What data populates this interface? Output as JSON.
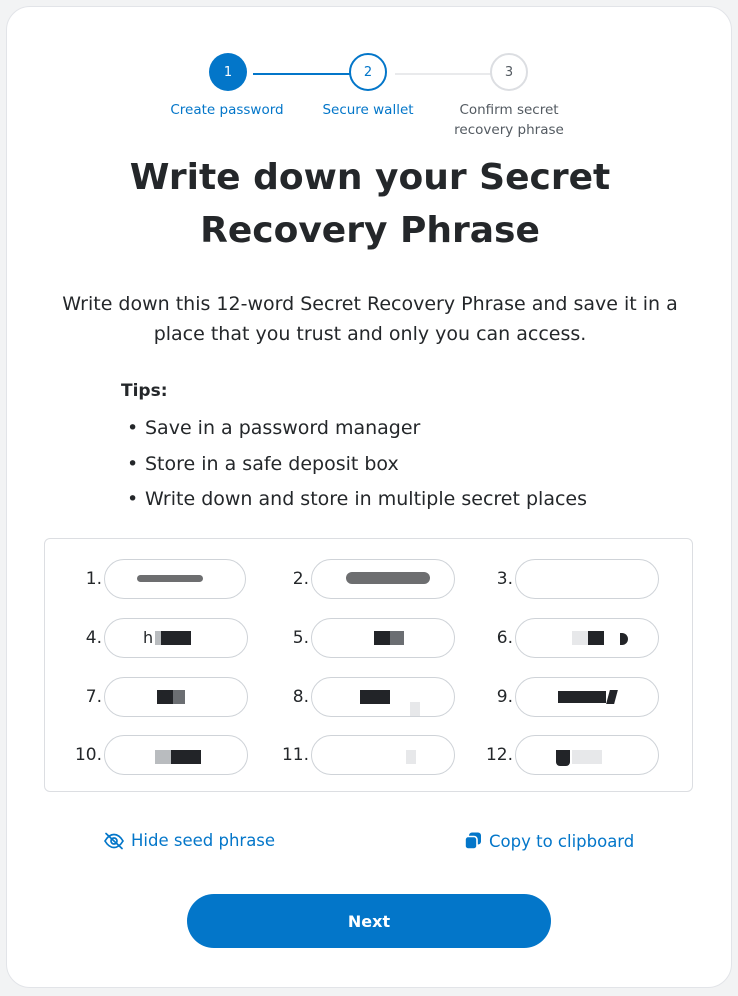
{
  "stepper": {
    "steps": [
      {
        "number": "1",
        "label": "Create password"
      },
      {
        "number": "2",
        "label": "Secure wallet"
      },
      {
        "number": "3",
        "label": "Confirm secret recovery phrase"
      }
    ]
  },
  "title": "Write down your Secret Recovery Phrase",
  "description": "Write down this 12-word Secret Recovery Phrase and save it in a place that you trust and only you can access.",
  "tips": {
    "heading": "Tips:",
    "items": [
      "Save in a password manager",
      "Store in a safe deposit box",
      "Write down and store in multiple secret places"
    ]
  },
  "phrase": {
    "words": [
      {
        "number": "1.",
        "text": ""
      },
      {
        "number": "2.",
        "text": ""
      },
      {
        "number": "3.",
        "text": ""
      },
      {
        "number": "4.",
        "text": "h"
      },
      {
        "number": "5.",
        "text": ""
      },
      {
        "number": "6.",
        "text": ""
      },
      {
        "number": "7.",
        "text": ""
      },
      {
        "number": "8.",
        "text": ""
      },
      {
        "number": "9.",
        "text": ""
      },
      {
        "number": "10.",
        "text": ""
      },
      {
        "number": "11.",
        "text": ""
      },
      {
        "number": "12.",
        "text": ""
      }
    ]
  },
  "actions": {
    "hide_label": "Hide seed phrase",
    "copy_label": "Copy to clipboard",
    "next_label": "Next"
  },
  "colors": {
    "accent": "#0376c9",
    "text": "#24272a",
    "muted": "#535a61",
    "border": "#dcdee2"
  },
  "icons": {
    "hide": "eye-slash-icon",
    "copy": "copy-icon"
  }
}
